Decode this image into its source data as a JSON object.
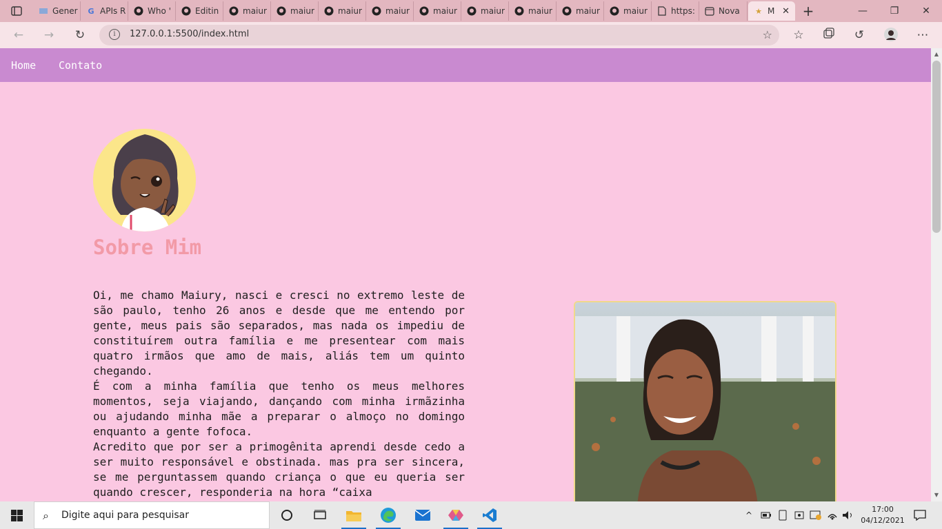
{
  "browser": {
    "tabs": [
      {
        "label": "Gener",
        "icon": "document-icon"
      },
      {
        "label": "APIs R",
        "icon": "google-icon"
      },
      {
        "label": "Who '",
        "icon": "github-icon"
      },
      {
        "label": "Editin",
        "icon": "github-icon"
      },
      {
        "label": "maiur",
        "icon": "github-icon"
      },
      {
        "label": "maiur",
        "icon": "github-icon"
      },
      {
        "label": "maiur",
        "icon": "github-icon"
      },
      {
        "label": "maiur",
        "icon": "github-icon"
      },
      {
        "label": "maiur",
        "icon": "github-icon"
      },
      {
        "label": "maiur",
        "icon": "github-icon"
      },
      {
        "label": "maiur",
        "icon": "github-icon"
      },
      {
        "label": "maiur",
        "icon": "github-icon"
      },
      {
        "label": "maiur",
        "icon": "github-icon"
      },
      {
        "label": "https:",
        "icon": "file-icon"
      },
      {
        "label": "Nova",
        "icon": "calendar-icon"
      },
      {
        "label": "M",
        "icon": "star-icon",
        "active": true
      }
    ],
    "url": "127.0.0.1:5500/index.html"
  },
  "site": {
    "nav": {
      "home": "Home",
      "contact": "Contato"
    },
    "title": "Sobre Mim",
    "bio": [
      "Oi, me chamo Maiury, nasci e cresci no extremo leste de são paulo, tenho 26 anos e desde que me entendo por gente, meus pais são separados, mas nada os impediu de constituírem outra família e me presentear com mais quatro irmãos que amo de mais, aliás tem um quinto chegando.",
      "É com a minha família que tenho os meus melhores momentos, seja viajando, dançando com minha irmãzinha ou ajudando minha mãe a preparar o almoço no domingo enquanto a gente fofoca.",
      "Acredito que por ser a primogênita aprendi desde cedo a ser muito responsável e obstinada. mas pra ser sincera, se me perguntassem quando criança o que eu queria ser quando crescer, responderia na hora “caixa"
    ]
  },
  "taskbar": {
    "search_placeholder": "Digite aqui para pesquisar",
    "time": "17:00",
    "date": "04/12/2021"
  },
  "colors": {
    "page_bg": "#fbc8e2",
    "nav_bg": "#c98ad0",
    "title": "#f29aa7",
    "tab_strip": "#e3b7c0"
  }
}
